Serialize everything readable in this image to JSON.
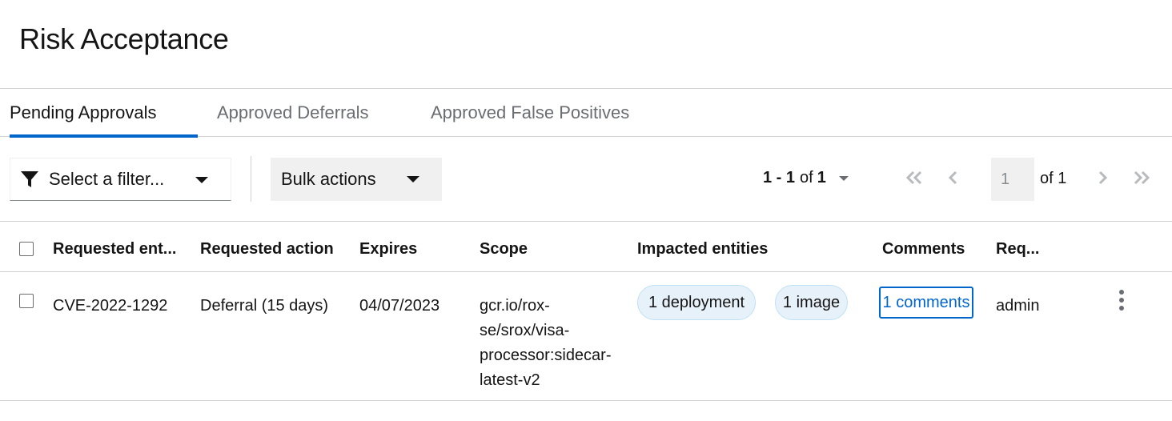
{
  "page": {
    "title": "Risk Acceptance"
  },
  "tabs": [
    {
      "label": "Pending Approvals",
      "active": true
    },
    {
      "label": "Approved Deferrals",
      "active": false
    },
    {
      "label": "Approved False Positives",
      "active": false
    }
  ],
  "toolbar": {
    "filter_placeholder": "Select a filter...",
    "bulk_actions_label": "Bulk actions",
    "pagination": {
      "range": "1 - 1",
      "of_label": "of",
      "total": "1",
      "current_page": "1",
      "page_of": "of 1"
    }
  },
  "table": {
    "columns": [
      "Requested ent...",
      "Requested action",
      "Expires",
      "Scope",
      "Impacted entities",
      "Comments",
      "Req..."
    ],
    "rows": [
      {
        "requested_entity": "CVE-2022-1292",
        "requested_action": "Deferral (15 days)",
        "expires": "04/07/2023",
        "scope": "gcr.io/rox-se/srox/visa-processor:sidecar-latest-v2",
        "impacted_deployments": "1 deployment",
        "impacted_images": "1 image",
        "comments": "1 comments",
        "requester": "admin"
      }
    ]
  },
  "colors": {
    "accent": "#0066cc",
    "chip_bg": "#e7f1fa",
    "chip_border": "#bee1f4"
  },
  "icons": [
    "filter-icon",
    "caret-down-icon",
    "angle-double-left-icon",
    "angle-left-icon",
    "angle-right-icon",
    "angle-double-right-icon",
    "kebab-icon"
  ]
}
